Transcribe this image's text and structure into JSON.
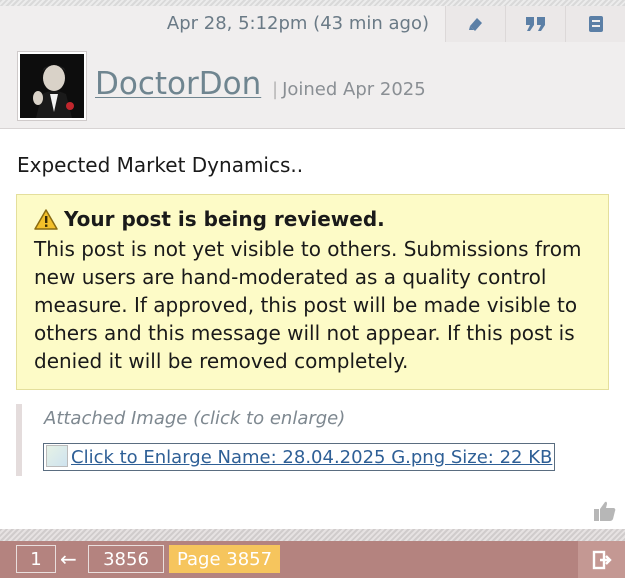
{
  "post": {
    "time": "Apr 28, 5:12pm (43 min ago)",
    "title": "Expected Market Dynamics.."
  },
  "actions": {
    "edit_icon": "edit-icon",
    "quote_icon": "quote-icon",
    "flag_icon": "flag-icon"
  },
  "author": {
    "username": "DoctorDon",
    "separator": "|",
    "joined": "Joined Apr 2025"
  },
  "review_notice": {
    "heading": "Your post is being reviewed.",
    "body": "This post is not yet visible to others. Submissions from new users are hand-moderated as a quality control measure. If approved, this post will be made visible to others and this message will not appear. If this post is denied it will be removed completely."
  },
  "attachment": {
    "label": "Attached Image (click to enlarge)",
    "link_text": "Click to Enlarge Name: 28.04.2025 G.png Size: 22 KB"
  },
  "pager": {
    "first": "1",
    "arrow": "←",
    "prev": "3856",
    "current": "Page 3857"
  },
  "colors": {
    "header_bg": "#f0eeee",
    "notice_bg": "#fdfbc7",
    "pager_bg": "#b4837f",
    "current_page": "#f6c55d",
    "username": "#6f8590"
  }
}
